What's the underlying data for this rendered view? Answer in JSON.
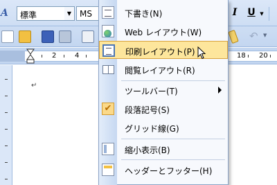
{
  "toolbar": {
    "style_icon": "A",
    "style_value": "標準",
    "font_value": "MS",
    "italic_label": "I",
    "underline_label": "U",
    "dropdown_arrow": "▼",
    "undo_glyph": "↶"
  },
  "ruler": {
    "numbers": [
      "2",
      "4",
      "18",
      "20"
    ]
  },
  "document": {
    "paragraph_mark": "↵"
  },
  "menu": {
    "items": [
      {
        "label": "下書き(N)",
        "icon": "draft-view-icon"
      },
      {
        "label": "Web レイアウト(W)",
        "icon": "web-layout-icon"
      },
      {
        "label": "印刷レイアウト(P)",
        "icon": "print-layout-icon",
        "highlighted": true
      },
      {
        "label": "閲覧レイアウト(R)",
        "icon": "reading-layout-icon"
      },
      {
        "label": "ツールバー(T)",
        "submenu": true
      },
      {
        "label": "段落記号(S)",
        "icon": "checkmark-icon",
        "checked": true
      },
      {
        "label": "グリッド線(G)"
      },
      {
        "label": "縮小表示(B)",
        "icon": "thumbnail-icon"
      },
      {
        "label": "ヘッダーとフッター(H)",
        "icon": "header-footer-icon"
      }
    ],
    "check_glyph": "✔"
  },
  "colors": {
    "menu_highlight": "#fde69c",
    "menu_highlight_border": "#d9a33d",
    "toolbar_bg": "#c3d6f0"
  }
}
